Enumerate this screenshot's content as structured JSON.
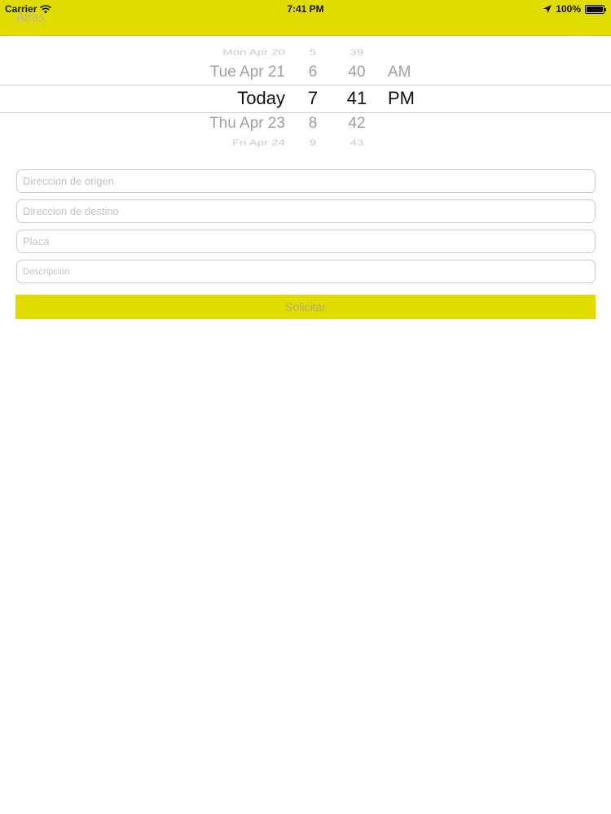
{
  "status_bar": {
    "carrier": "Carrier",
    "time": "7:41 PM",
    "battery": "100%"
  },
  "nav": {
    "back_label": "Atras"
  },
  "picker": {
    "dates": [
      "Mon Apr 20",
      "Tue Apr 21",
      "Today",
      "Thu Apr 23",
      "Fri Apr 24"
    ],
    "hours": [
      "5",
      "6",
      "7",
      "8",
      "9"
    ],
    "minutes": [
      "39",
      "40",
      "41",
      "42",
      "43"
    ],
    "ampm": [
      "AM",
      "PM"
    ],
    "selected": {
      "date": "Today",
      "hour": "7",
      "minute": "41",
      "ampm": "PM"
    }
  },
  "form": {
    "origin_placeholder": "Direccion de origen",
    "destination_placeholder": "Direccion de destino",
    "plate_placeholder": "Placa",
    "description_placeholder": "Descripcion",
    "submit_label": "Solicitar"
  },
  "colors": {
    "accent": "#e1dc00",
    "picker_selected": "#111111",
    "picker_unselected": "#a0a0a0"
  }
}
